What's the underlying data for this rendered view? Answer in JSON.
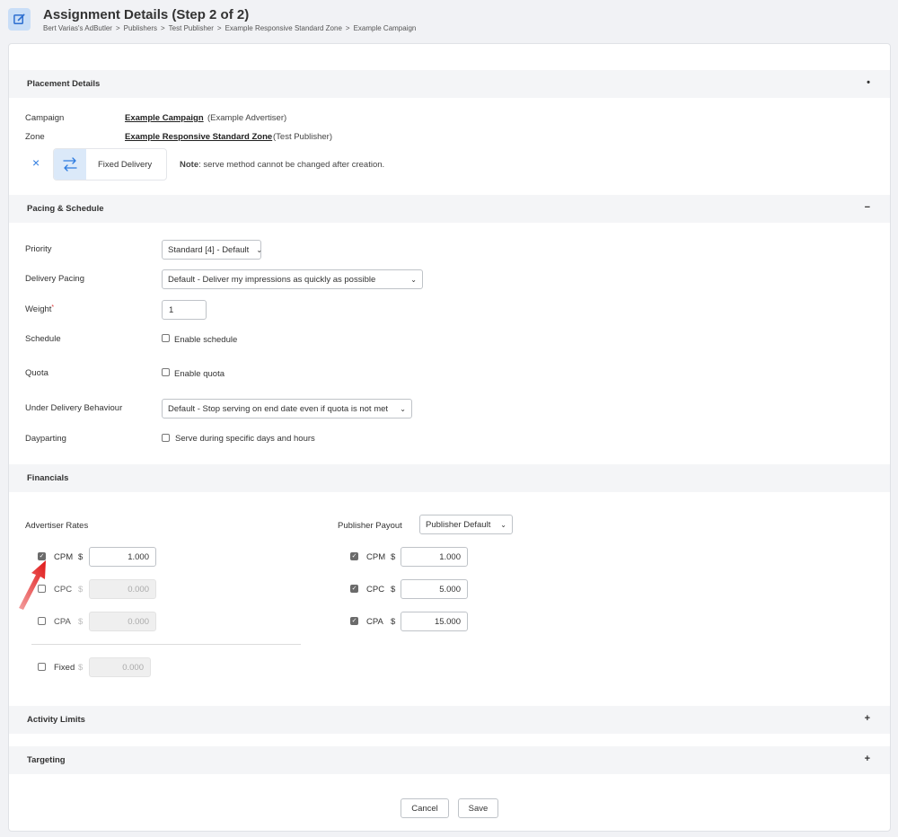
{
  "header": {
    "title": "Assignment Details (Step 2 of 2)",
    "breadcrumb": [
      "Bert Varias's AdButler",
      "Publishers",
      "Test Publisher",
      "Example Responsive Standard Zone",
      "Example Campaign"
    ],
    "separator": ">"
  },
  "placement": {
    "section_title": "Placement Details",
    "toggle": "•",
    "campaign_label": "Campaign",
    "campaign_link": "Example Campaign",
    "campaign_owner": "(Example Advertiser)",
    "zone_label": "Zone",
    "zone_link": "Example Responsive Standard Zone",
    "zone_owner": "(Test Publisher)",
    "remove_icon": "×",
    "serve_method": "Fixed Delivery",
    "note_bold": "Note",
    "note_text": ": serve method cannot be changed after creation."
  },
  "pacing": {
    "section_title": "Pacing & Schedule",
    "toggle": "−",
    "priority_label": "Priority",
    "priority_value": "Standard [4] - Default",
    "delivery_label": "Delivery Pacing",
    "delivery_value": "Default - Deliver my impressions as quickly as possible",
    "weight_label": "Weight",
    "weight_required": "*",
    "weight_value": "1",
    "schedule_label": "Schedule",
    "schedule_checkbox": "Enable schedule",
    "quota_label": "Quota",
    "quota_checkbox": "Enable quota",
    "under_label": "Under Delivery Behaviour",
    "under_value": "Default - Stop serving on end date even if quota is not met",
    "daypart_label": "Dayparting",
    "daypart_checkbox": "Serve during specific days and hours"
  },
  "financials": {
    "section_title": "Financials",
    "advertiser_title": "Advertiser Rates",
    "currency": "$",
    "advertiser": [
      {
        "label": "CPM",
        "value": "1.000",
        "checked": true
      },
      {
        "label": "CPC",
        "value": "0.000",
        "checked": false
      },
      {
        "label": "CPA",
        "value": "0.000",
        "checked": false
      }
    ],
    "fixed": {
      "label": "Fixed",
      "value": "0.000",
      "checked": false
    },
    "publisher_title": "Publisher Payout",
    "publisher_select": "Publisher Default",
    "publisher": [
      {
        "label": "CPM",
        "value": "1.000",
        "checked": true
      },
      {
        "label": "CPC",
        "value": "5.000",
        "checked": true
      },
      {
        "label": "CPA",
        "value": "15.000",
        "checked": true
      }
    ]
  },
  "activity": {
    "section_title": "Activity Limits",
    "toggle": "+"
  },
  "targeting": {
    "section_title": "Targeting",
    "toggle": "+"
  },
  "footer": {
    "cancel_label": "Cancel",
    "save_label": "Save"
  },
  "colors": {
    "accent": "#2d7be0",
    "icon_bg": "#c9def7",
    "arrow": "#e02020"
  }
}
